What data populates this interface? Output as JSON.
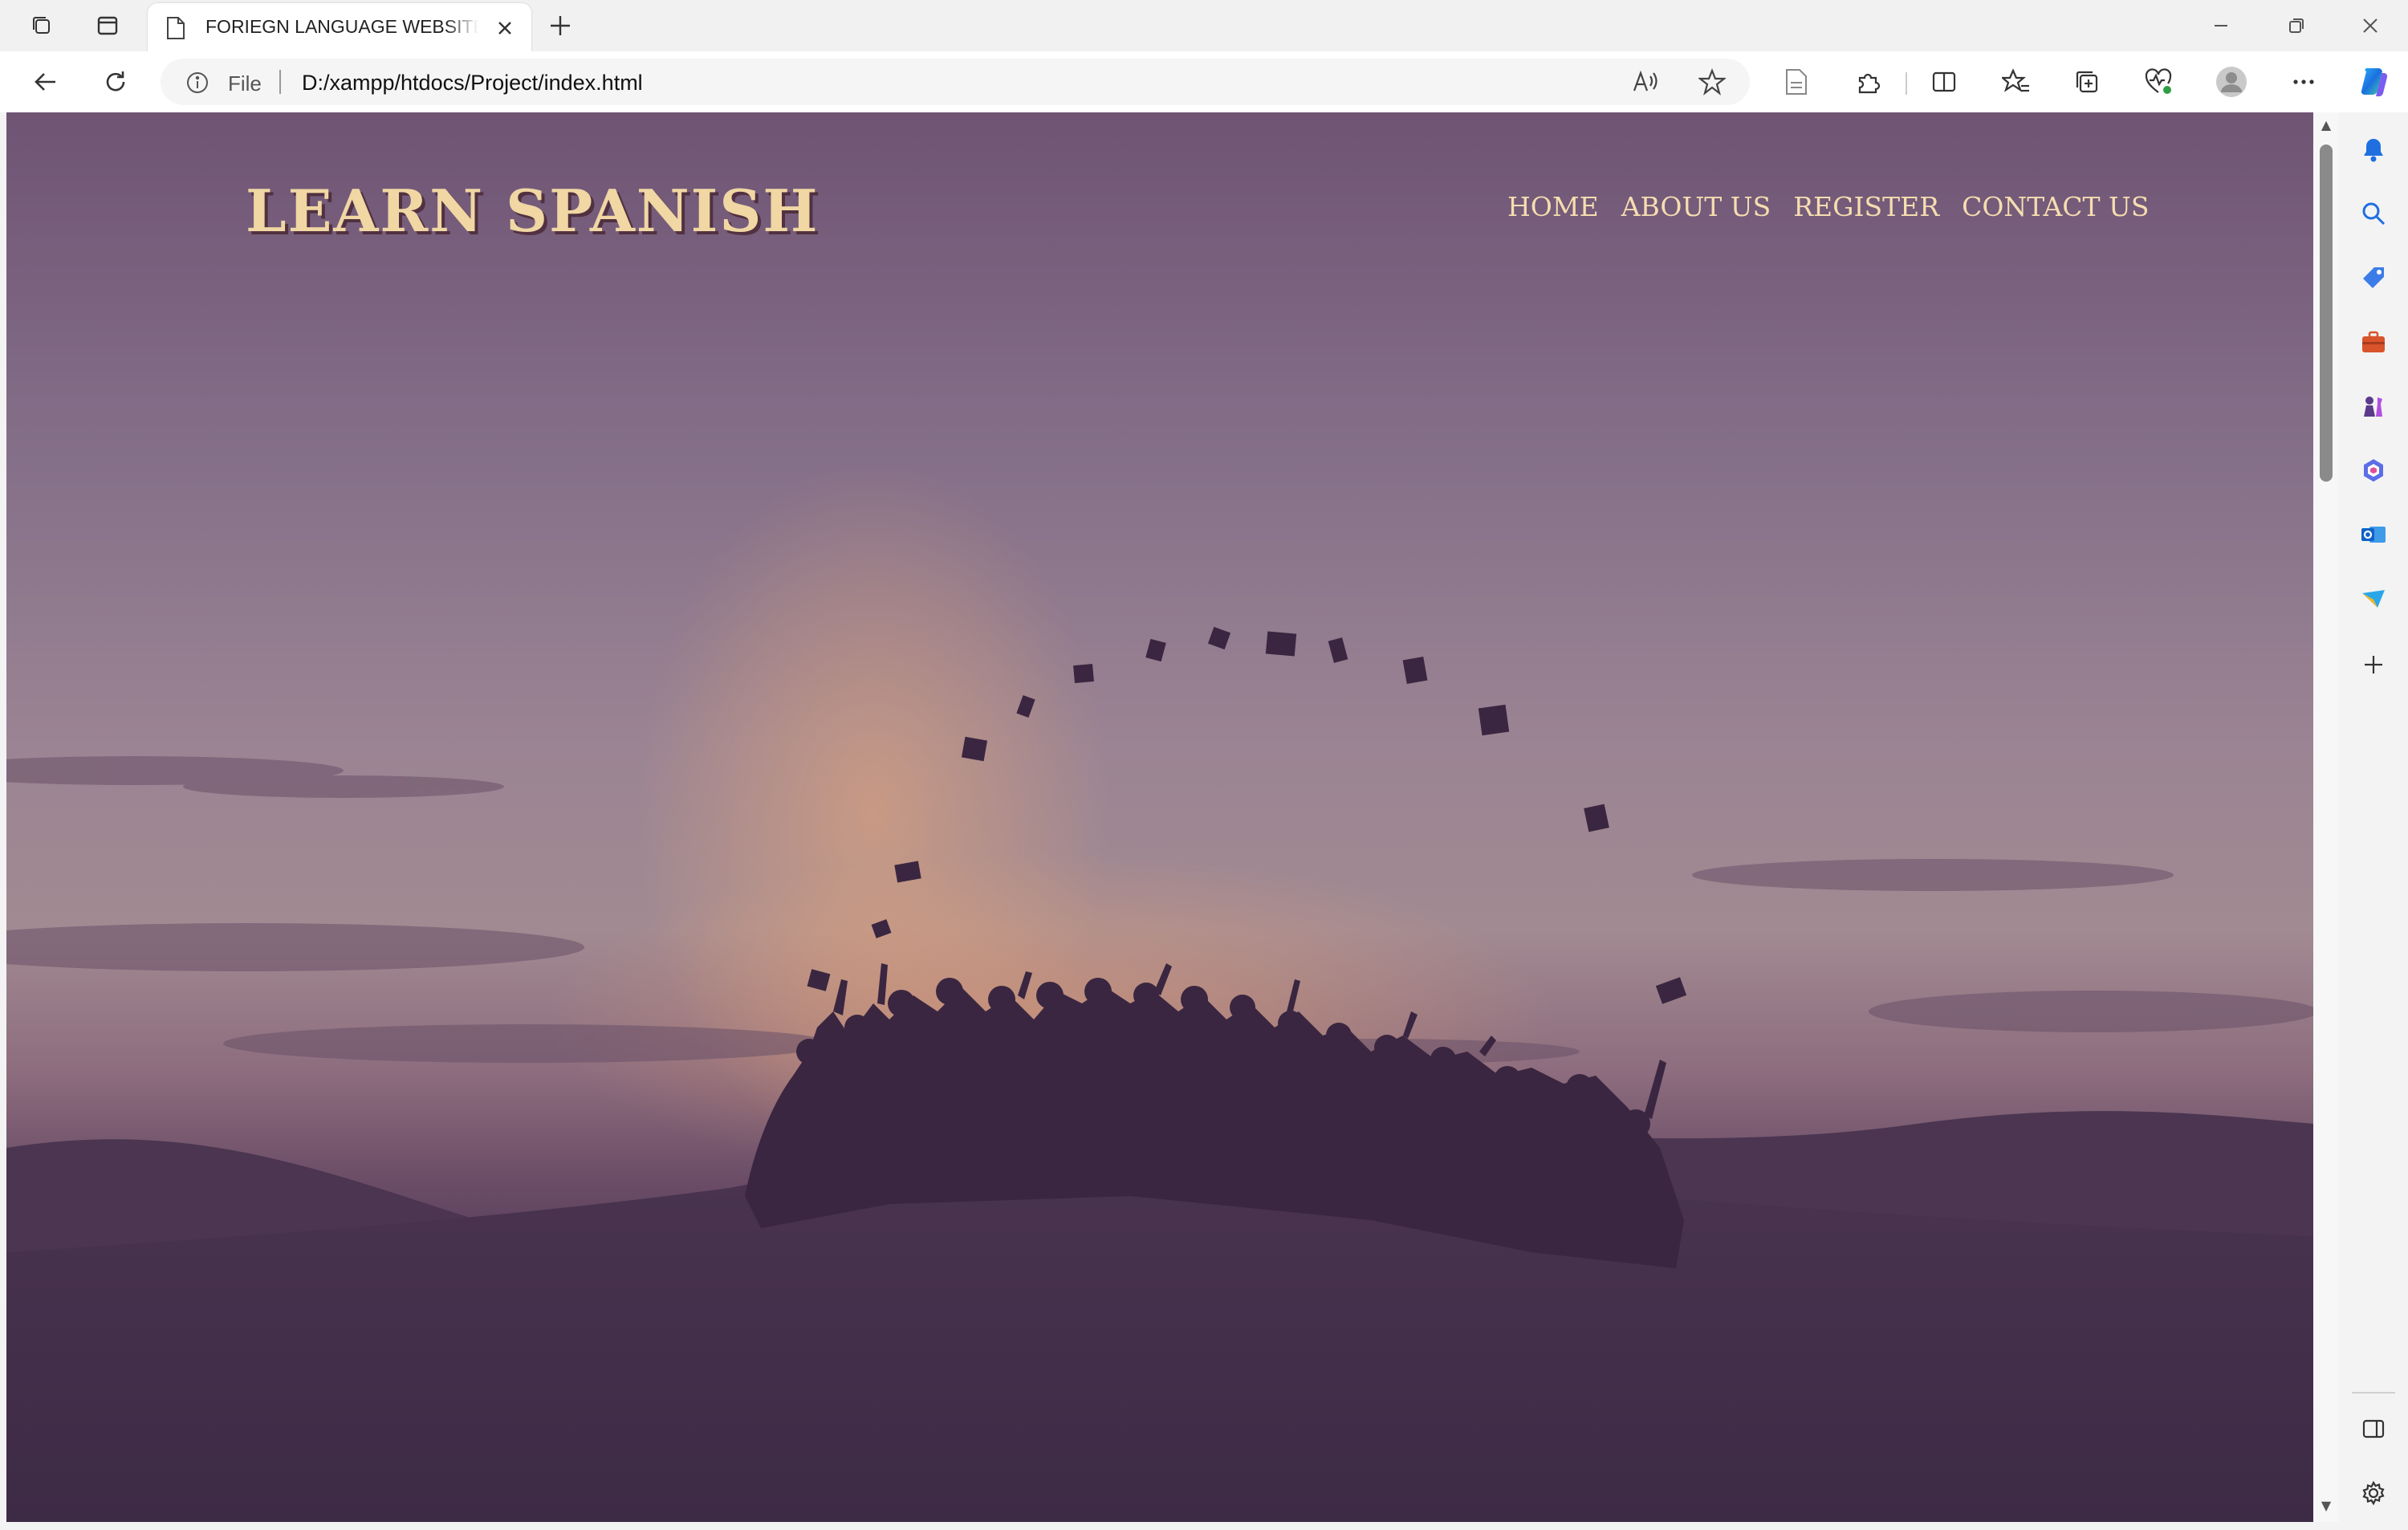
{
  "browser": {
    "tab_title": "FORIEGN LANGUAGE WEBSITE R",
    "address_scheme": "File",
    "address_url": "D:/xampp/htdocs/Project/index.html"
  },
  "page": {
    "logo": "LEARN SPANISH",
    "nav": [
      "HOME",
      "ABOUT US",
      "REGISTER",
      "CONTACT US"
    ]
  },
  "colors": {
    "logo": "#f0d7a3",
    "nav": "#f6ddb0",
    "sky_top": "#6f5474",
    "glow": "#f6a86e",
    "ground": "#3f2b47"
  }
}
